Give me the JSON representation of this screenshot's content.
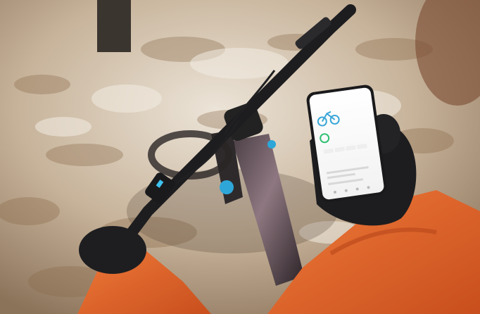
{
  "scene": {
    "description_colors": {
      "ground": "#c9b9a3",
      "leaves": "#8a6a4a",
      "jacket": "#e8662a",
      "glove": "#1e1e20",
      "bike_frame": "#2b2326",
      "accent_blue": "#2ea6d8"
    }
  },
  "phone": {
    "brand": "",
    "title": "",
    "bike_name": "",
    "subtitle": "",
    "stat_primary": "",
    "stat_secondary": "",
    "section_label": "",
    "last_item": "",
    "accent_color": "#e4002b",
    "ring_color": "#2fbf71"
  }
}
